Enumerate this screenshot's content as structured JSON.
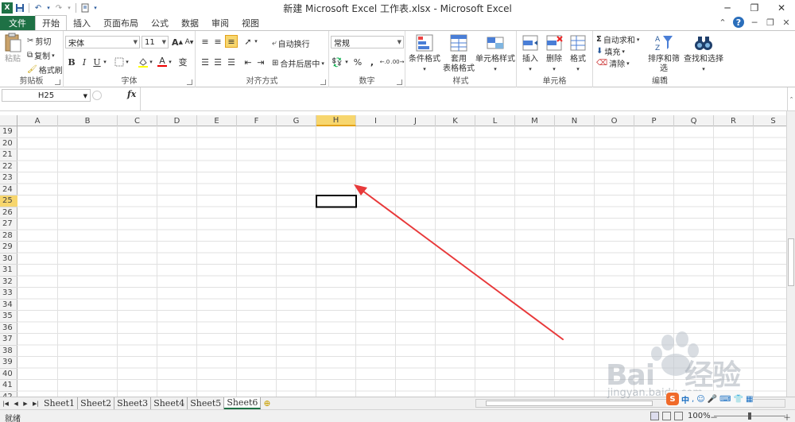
{
  "window": {
    "title": "新建 Microsoft Excel 工作表.xlsx - Microsoft Excel",
    "controls": [
      "─",
      "❐",
      "✕"
    ]
  },
  "quick_access": [
    "save-icon",
    "undo-icon",
    "redo-icon",
    "customize-icon"
  ],
  "ribbon_tabs": {
    "file": "文件",
    "items": [
      "开始",
      "插入",
      "页面布局",
      "公式",
      "数据",
      "审阅",
      "视图"
    ],
    "active": "开始"
  },
  "ribbon": {
    "clipboard": {
      "label": "剪贴板",
      "paste": "粘贴",
      "cut": "剪切",
      "copy": "复制",
      "format_painter": "格式刷"
    },
    "font": {
      "label": "字体",
      "font_name": "宋体",
      "font_size": "11",
      "bold": "B",
      "italic": "I",
      "underline": "U",
      "grow": "A",
      "shrink": "A",
      "phonetic": "变"
    },
    "alignment": {
      "label": "对齐方式",
      "wrap": "自动换行",
      "merge": "合并后居中"
    },
    "number": {
      "label": "数字",
      "format": "常规",
      "percent": "%",
      "comma": ",",
      "inc_decimal": ".0 .00",
      "dec_decimal": ".00 .0"
    },
    "styles": {
      "label": "样式",
      "conditional": "条件格式",
      "table_line1": "套用",
      "table_line2": "表格格式",
      "cell_styles": "单元格样式"
    },
    "cells": {
      "label": "单元格",
      "insert": "插入",
      "delete": "删除",
      "format": "格式"
    },
    "editing": {
      "label": "编辑",
      "autosum": "自动求和",
      "fill": "填充",
      "clear": "清除",
      "sort": "排序和筛选",
      "find": "查找和选择"
    }
  },
  "formula_bar": {
    "name_box": "H25",
    "fx": "fx",
    "formula": ""
  },
  "grid": {
    "columns": [
      "A",
      "B",
      "C",
      "D",
      "E",
      "F",
      "G",
      "H",
      "I",
      "J",
      "K",
      "L",
      "M",
      "N",
      "O",
      "P",
      "Q",
      "R",
      "S"
    ],
    "rows": [
      "19",
      "20",
      "21",
      "22",
      "23",
      "24",
      "25",
      "26",
      "27",
      "28",
      "29",
      "30",
      "31",
      "32",
      "33",
      "34",
      "35",
      "36",
      "37",
      "38",
      "39",
      "40",
      "41",
      "42"
    ],
    "selected_col": "H",
    "selected_row": "25",
    "selected_cell": "H25"
  },
  "sheets": {
    "items": [
      "Sheet1",
      "Sheet2",
      "Sheet3",
      "Sheet4",
      "Sheet5",
      "Sheet6"
    ],
    "active": "Sheet6"
  },
  "status": {
    "ready": "就绪",
    "zoom": "100%",
    "zoom_minus": "－",
    "zoom_plus": "＋"
  },
  "annotation": {
    "color": "#e8393a"
  },
  "watermark": {
    "brand": "Bai",
    "brand2": "经验",
    "url": "jingyan.baidu.com"
  },
  "ime": {
    "logo": "S",
    "lang": "中"
  },
  "colors": {
    "excel_green": "#1e7145",
    "selection_header": "#f7d66e",
    "grid_line": "#e1e1e1"
  }
}
